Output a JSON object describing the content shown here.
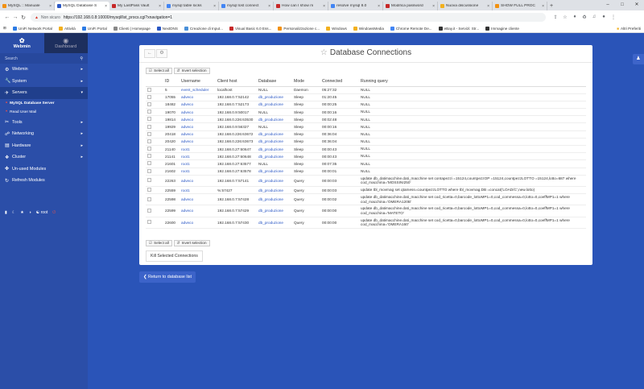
{
  "browser": {
    "tabs": [
      {
        "label": "MySQL :: Manuale",
        "color": "#f29111",
        "active": false
      },
      {
        "label": "MySQL Database S",
        "color": "#2a57c4",
        "active": true
      },
      {
        "label": "My LastPass Vault",
        "color": "#c62828",
        "active": false
      },
      {
        "label": "mysql table locks",
        "color": "#4285f4",
        "active": false
      },
      {
        "label": "mysql lost connect",
        "color": "#4285f4",
        "active": false
      },
      {
        "label": "How can I show m",
        "color": "#c62828",
        "active": false
      },
      {
        "label": "resolve mysql 8.0",
        "color": "#4285f4",
        "active": false
      },
      {
        "label": "Modifica password",
        "color": "#c62828",
        "active": false
      },
      {
        "label": "Nuova discussione",
        "color": "#f2b01e",
        "active": false
      },
      {
        "label": "SHOW FULL PROC",
        "color": "#f29111",
        "active": false
      }
    ],
    "url_warning": "Non sicuro",
    "url": "https://192.168.0.8:10000/mysql/list_procs.cgi?xnavigation=1",
    "bookmarks": [
      "UniFi Network Portal",
      "Attività",
      "UniFi Portal",
      "Clienti | Homepage",
      "NextDNS",
      "Creazione di Input...",
      "Visual Basic 6.0 Ess...",
      "Personalizzazione c...",
      "Windows",
      "WindowsMedia",
      "Chrome Remote De...",
      "eBay.it - Servizi: Str...",
      "Immagine cliente"
    ],
    "bookmarks_other": "Altri Preferiti"
  },
  "sidebar": {
    "tab_webmin": "Webmin",
    "tab_dashboard": "Dashboard",
    "search_placeholder": "Search",
    "items": [
      {
        "label": "Webmin",
        "icon": "gear-icon"
      },
      {
        "label": "System",
        "icon": "wrench-icon"
      },
      {
        "label": "Servers",
        "icon": "rocket-icon"
      }
    ],
    "sub_items": [
      "MySQL Database Server",
      "Read User Mail"
    ],
    "items_after": [
      {
        "label": "Tools",
        "icon": "tools-icon"
      },
      {
        "label": "Networking",
        "icon": "network-icon"
      },
      {
        "label": "Hardware",
        "icon": "hardware-icon"
      },
      {
        "label": "Cluster",
        "icon": "cluster-icon"
      },
      {
        "label": "Un-used Modules",
        "icon": "puzzle-icon"
      },
      {
        "label": "Refresh Modules",
        "icon": "refresh-icon"
      }
    ],
    "user": "root"
  },
  "page": {
    "title": "Database Connections",
    "select_all": "Select all",
    "invert_selection": "Invert selection",
    "kill_button": "Kill Selected Connections",
    "return_button": "Return to database list"
  },
  "table": {
    "headers": [
      "ID",
      "Username",
      "Client host",
      "Database",
      "Mode",
      "Connected",
      "Running query"
    ],
    "rows": [
      {
        "id": "5",
        "user": "event_scheduler",
        "host": "localhost",
        "db": "NULL",
        "mode": "Daemon",
        "conn": "05:27:32",
        "query": "NULL",
        "tall": false
      },
      {
        "id": "17055",
        "user": "adveco",
        "host": "192.168.0.7:52142",
        "db": "db_produzione",
        "mode": "Sleep",
        "conn": "01:20:45",
        "query": "NULL",
        "tall": false
      },
      {
        "id": "18482",
        "user": "adveco",
        "host": "192.168.0.7:52173",
        "db": "db_produzione",
        "mode": "Sleep",
        "conn": "00:00:25",
        "query": "NULL",
        "tall": false
      },
      {
        "id": "19070",
        "user": "adveco",
        "host": "192.168.0.9:50017",
        "db": "NULL",
        "mode": "Sleep",
        "conn": "00:00:16",
        "query": "NULL",
        "tall": false
      },
      {
        "id": "19814",
        "user": "adveco",
        "host": "192.168.0.226:63530",
        "db": "db_produzione",
        "mode": "Sleep",
        "conn": "00:02:48",
        "query": "NULL",
        "tall": false
      },
      {
        "id": "19929",
        "user": "adveco",
        "host": "192.168.0.9:56327",
        "db": "NULL",
        "mode": "Sleep",
        "conn": "00:00:16",
        "query": "NULL",
        "tall": false
      },
      {
        "id": "20418",
        "user": "adveco",
        "host": "192.168.0.226:63672",
        "db": "db_produzione",
        "mode": "Sleep",
        "conn": "00:36:04",
        "query": "NULL",
        "tall": false
      },
      {
        "id": "20420",
        "user": "adveco",
        "host": "192.168.0.226:63673",
        "db": "db_produzione",
        "mode": "Sleep",
        "conn": "00:36:04",
        "query": "NULL",
        "tall": false
      },
      {
        "id": "21140",
        "user": "root1",
        "host": "192.168.0.27:60647",
        "db": "db_produzione",
        "mode": "Sleep",
        "conn": "00:00:43",
        "query": "NULL",
        "tall": false
      },
      {
        "id": "21141",
        "user": "root1",
        "host": "192.168.0.27:60648",
        "db": "db_produzione",
        "mode": "Sleep",
        "conn": "00:00:43",
        "query": "NULL",
        "tall": false
      },
      {
        "id": "21601",
        "user": "root1",
        "host": "192.168.0.27:63577",
        "db": "NULL",
        "mode": "Sleep",
        "conn": "00:07:35",
        "query": "NULL",
        "tall": false
      },
      {
        "id": "21602",
        "user": "root1",
        "host": "192.168.0.27:63578",
        "db": "db_produzione",
        "mode": "Sleep",
        "conn": "00:00:01",
        "query": "NULL",
        "tall": false
      },
      {
        "id": "22263",
        "user": "adveco",
        "host": "192.168.0.7:57141",
        "db": "db_produzione",
        "mode": "Query",
        "conn": "00:00:03",
        "query": "update db_datimacchine.dati_macchine set contapezzi =15124,countpezzOP =15124,countpezzLOTTO =15124,lotto=687 where cod_macchina='MOSSINI250'",
        "tall": true
      },
      {
        "id": "22559",
        "user": "root1",
        "host": "%:57427",
        "db": "db_produzione",
        "mode": "Query",
        "conn": "00:00:03",
        "query": "update tbl_movmag set qtamess=countpezzLOTTO where tbl_movmag.DB =concat('LOAD/C',new.lotto)",
        "tall": false
      },
      {
        "id": "22598",
        "user": "adveco",
        "host": "192.168.0.7:57428",
        "db": "db_produzione",
        "mode": "Query",
        "conn": "00:00:02",
        "query": "update db_datimacchine.dati_macchine set cod_ricetta=0,barcode_lottoMP1=0,cod_commessa=0,lotto=0,coeffMP1=1 where cod_macchina='OMERA120B'",
        "tall": true
      },
      {
        "id": "22599",
        "user": "adveco",
        "host": "192.168.0.7:57429",
        "db": "db_produzione",
        "mode": "Query",
        "conn": "00:00:00",
        "query": "update db_datimacchine.dati_macchine set cod_ricetta=0,barcode_lottoMP1=0,cod_commessa=0,lotto=0,coeffMP1=1 where cod_macchina='MATETO'",
        "tall": true
      },
      {
        "id": "22600",
        "user": "adveco",
        "host": "192.168.0.7:57430",
        "db": "db_produzione",
        "mode": "Query",
        "conn": "00:00:00",
        "query": "update db_datimacchine.dati_macchine set cod_ricetta=0,barcode_lottoMP1=0,cod_commessa=0,lotto=0,coeffMP1=1 where cod_macchina='OMERA160'",
        "tall": true
      }
    ]
  }
}
